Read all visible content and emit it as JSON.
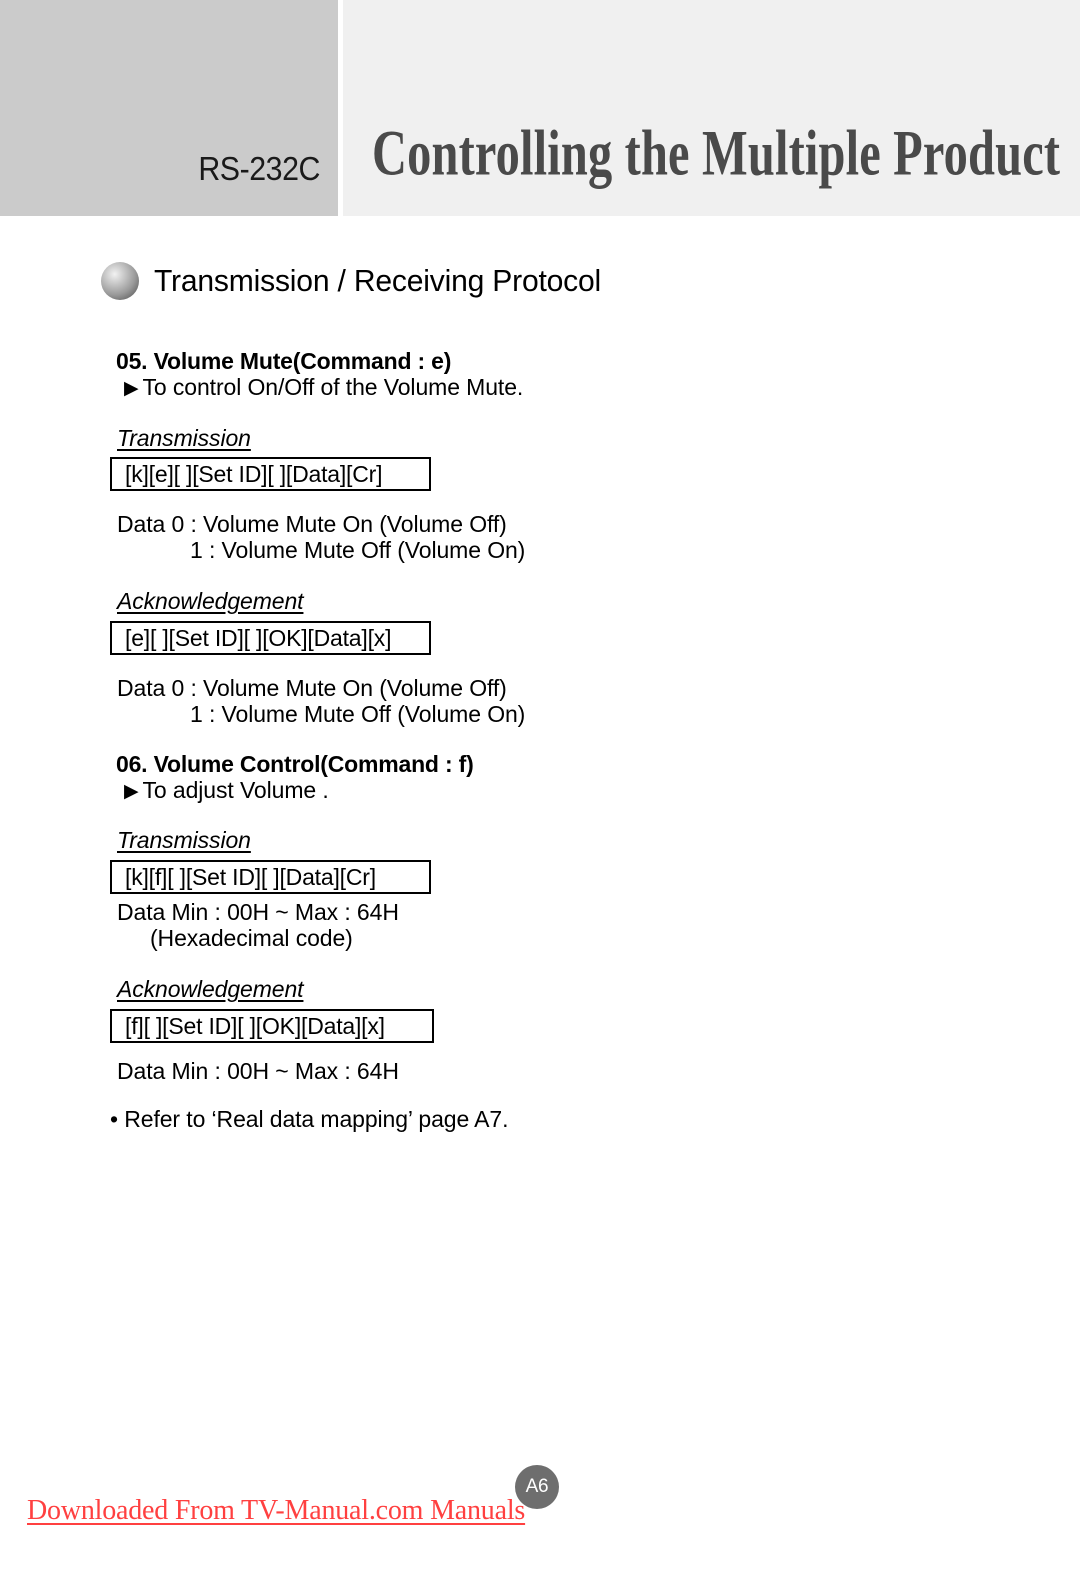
{
  "header": {
    "subtitle": "RS-232C",
    "title": "Controlling the Multiple Product"
  },
  "section": {
    "bullet_icon": "sphere-bullet-icon",
    "label": "Transmission / Receiving Protocol"
  },
  "commands": [
    {
      "heading": "05. Volume  Mute(Command : e)",
      "description": "To control On/Off of the Volume Mute.",
      "transmission_label": "Transmission",
      "transmission_code": "[k][e][ ][Set ID][ ][Data][Cr]",
      "transmission_data": [
        "Data 0 : Volume Mute On (Volume Off)",
        "1 : Volume Mute Off (Volume On)"
      ],
      "acknowledgement_label": "Acknowledgement",
      "acknowledgement_code": "[e][ ][Set ID][ ][OK][Data][x]",
      "acknowledgement_data": [
        "Data 0 : Volume Mute On (Volume Off)",
        "1 : Volume Mute Off (Volume On)"
      ]
    },
    {
      "heading": "06. Volume  Control(Command : f)",
      "description": "To adjust Volume .",
      "transmission_label": "Transmission",
      "transmission_code": "[k][f][ ][Set ID][ ][Data][Cr]",
      "transmission_data": [
        "Data        Min : 00H ~ Max : 64H",
        "(Hexadecimal code)"
      ],
      "acknowledgement_label": "Acknowledgement",
      "acknowledgement_code": "[f][ ][Set ID][ ][OK][Data][x]",
      "acknowledgement_data": [
        "Data        Min : 00H ~ Max : 64H"
      ],
      "note": "• Refer to ‘Real data mapping’ page A7."
    }
  ],
  "triangle_bullet": "▶",
  "footer": {
    "page_number": "A6",
    "watermark": "Downloaded From TV-Manual.com Manuals"
  },
  "colors": {
    "header_left_bg": "#cbcbcb",
    "header_right_bg": "#f0f0f0",
    "title_text": "#4a4a4a",
    "page_badge_bg": "#6e6e6e",
    "watermark_text": "#ff4040"
  }
}
